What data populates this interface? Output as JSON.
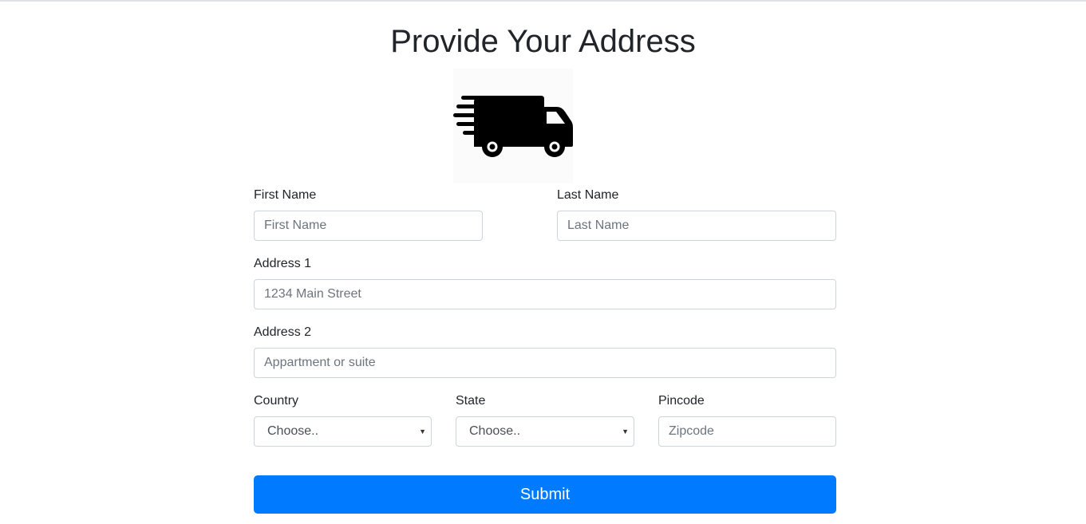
{
  "page": {
    "title": "Provide Your Address",
    "illustration_icon": "delivery-truck-icon"
  },
  "form": {
    "first_name": {
      "label": "First Name",
      "placeholder": "First Name",
      "value": ""
    },
    "last_name": {
      "label": "Last Name",
      "placeholder": "Last Name",
      "value": ""
    },
    "address1": {
      "label": "Address 1",
      "placeholder": "1234 Main Street",
      "value": ""
    },
    "address2": {
      "label": "Address 2",
      "placeholder": "Appartment or suite",
      "value": ""
    },
    "country": {
      "label": "Country",
      "selected": "Choose.."
    },
    "state": {
      "label": "State",
      "selected": "Choose.."
    },
    "pincode": {
      "label": "Pincode",
      "placeholder": "Zipcode",
      "value": ""
    },
    "submit_label": "Submit"
  },
  "colors": {
    "primary": "#007bff",
    "text": "#212529",
    "border": "#ced4da"
  }
}
